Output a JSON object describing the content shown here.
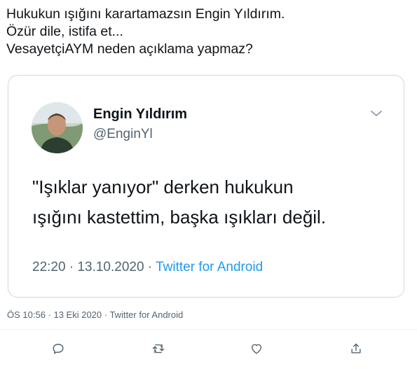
{
  "tweet": {
    "lines": [
      "Hukukun ışığını karartamazsın Engin Yıldırım.",
      "Özür dile, istifa et...",
      "VesayetçiAYM neden açıklama yapmaz?"
    ],
    "meta": "ÖS 10:56 · 13 Eki 2020 · Twitter for Android"
  },
  "quoted": {
    "name": "Engin Yıldırım",
    "handle": "@EnginYl",
    "body_lines": [
      "\"Işıklar yanıyor\" derken hukukun",
      "ışığını kastettim, başka ışıkları değil."
    ],
    "time": "22:20 · 13.10.2020 · ",
    "source": "Twitter for Android"
  },
  "icons": {
    "avatar": "avatar-photo",
    "menu": "chevron-down-icon",
    "reply": "reply-icon",
    "retweet": "retweet-icon",
    "like": "heart-icon",
    "share": "share-icon"
  },
  "colors": {
    "text": "#0f1419",
    "secondary": "#536471",
    "link": "#1d9bf0",
    "border": "#cfd9de"
  }
}
